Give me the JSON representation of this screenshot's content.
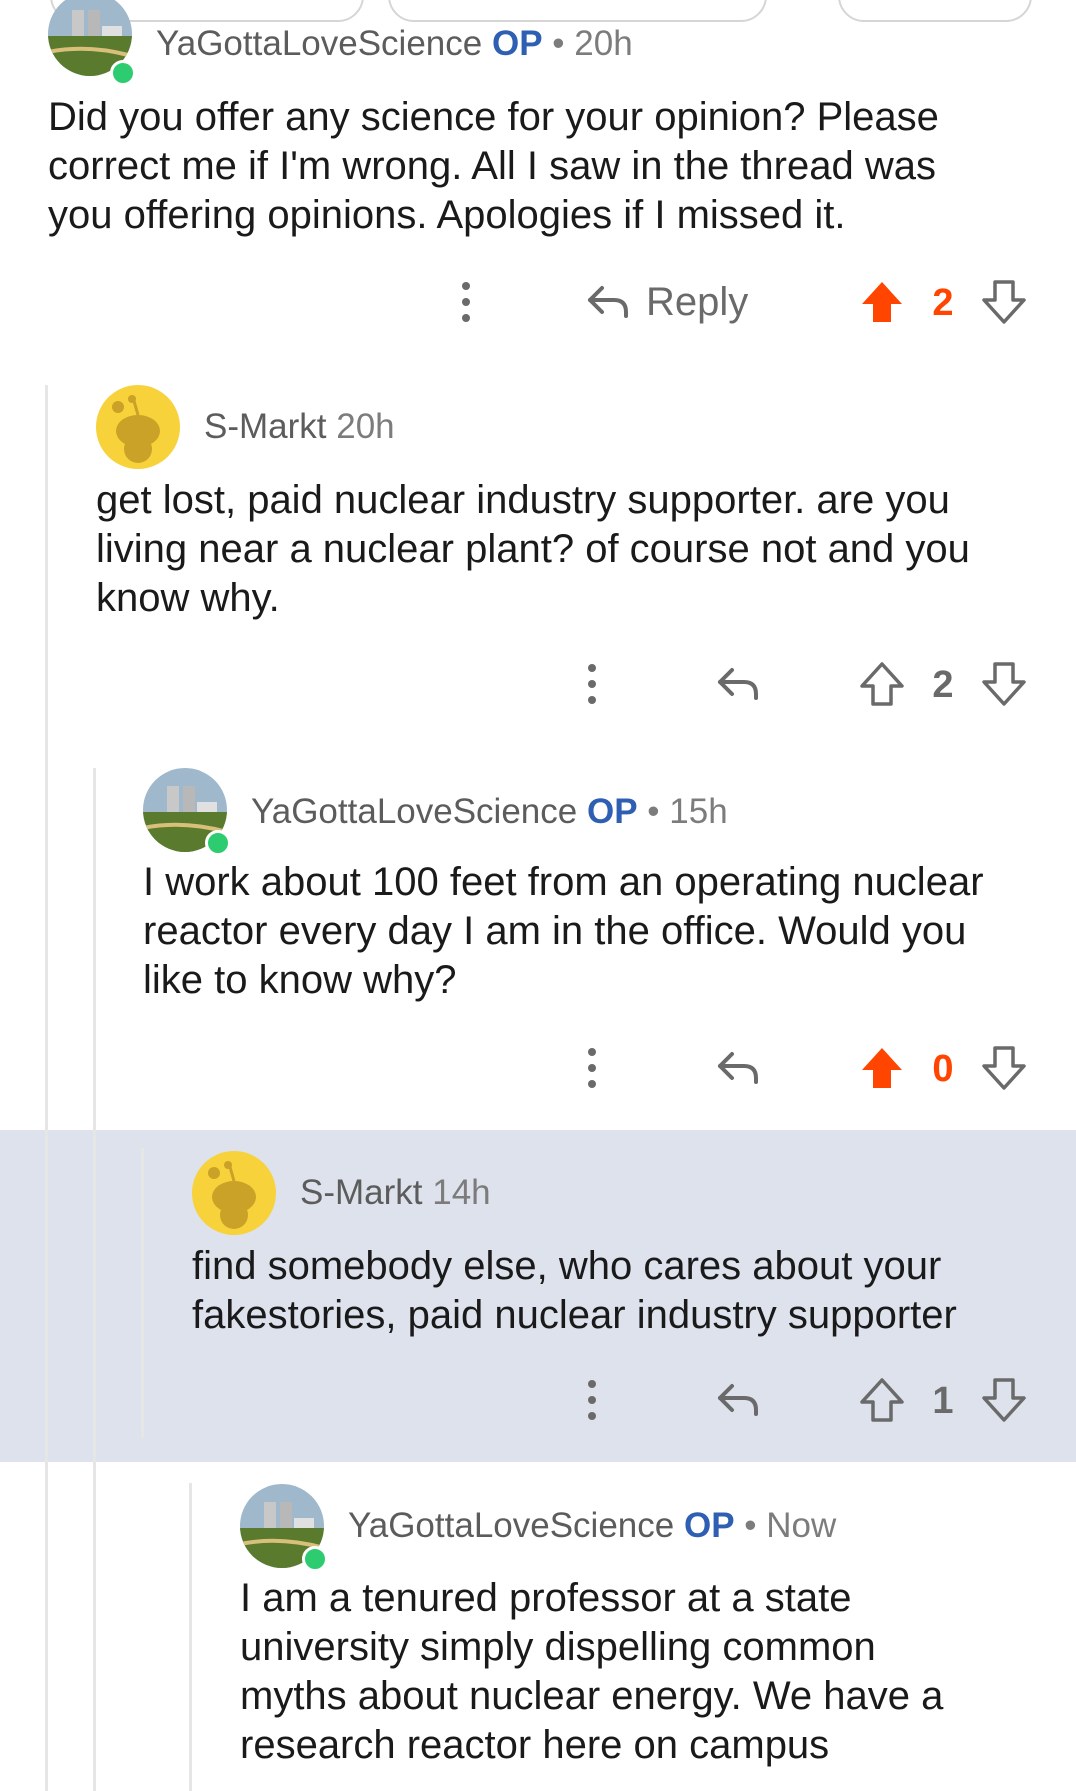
{
  "colors": {
    "upvote_active": "#ff4500",
    "op_badge": "#2e5fb3",
    "highlight_bg": "#dde2ec",
    "online": "#2ecc71"
  },
  "comments": [
    {
      "author": "YaGottaLoveScience",
      "op": "OP",
      "separator": "•",
      "time": "20h",
      "body": "Did you offer any science for your opinion? Please\ncorrect me if I'm wrong. All I saw in the thread was\nyou offering opinions. Apologies if I missed it.",
      "reply_label": "Reply",
      "score": "2",
      "upvoted": true,
      "avatar_icon": "nuclear-plant-avatar-icon"
    },
    {
      "author": "S-Markt",
      "time": "20h",
      "body": "get lost, paid nuclear industry supporter. are you\nliving near a nuclear plant? of course not and you\nknow why.",
      "score": "2",
      "upvoted": false,
      "avatar_icon": "snoo-avatar-icon"
    },
    {
      "author": "YaGottaLoveScience",
      "op": "OP",
      "separator": "•",
      "time": "15h",
      "body": "I work about 100 feet from an operating nuclear\nreactor every day I am in the office. Would you\nlike to know why?",
      "score": "0",
      "upvoted": true,
      "avatar_icon": "nuclear-plant-avatar-icon"
    },
    {
      "author": "S-Markt",
      "time": "14h",
      "body": "find somebody else, who cares about your\nfakestories, paid nuclear industry supporter",
      "score": "1",
      "upvoted": false,
      "highlighted": true,
      "avatar_icon": "snoo-avatar-icon"
    },
    {
      "author": "YaGottaLoveScience",
      "op": "OP",
      "separator": "•",
      "time": "Now",
      "body": "I am a tenured professor at a state\nuniversity simply dispelling common\nmyths about nuclear energy. We have a\nresearch reactor here on campus",
      "avatar_icon": "nuclear-plant-avatar-icon"
    }
  ]
}
